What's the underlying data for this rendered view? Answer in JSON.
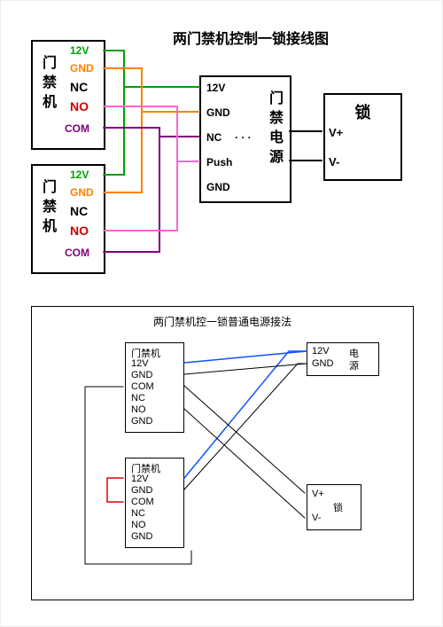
{
  "diagram1": {
    "title": "两门禁机控制一锁接线图",
    "access_unit_label": "门禁机",
    "controller_label": "门禁电源",
    "lock_label": "锁",
    "pins_access": {
      "v12": "12V",
      "gnd": "GND",
      "nc": "NC",
      "no": "NO",
      "com": "COM"
    },
    "pins_ctrl": {
      "v12": "12V",
      "gnd": "GND",
      "nc": "NC",
      "push": "Push",
      "gnd2": "GND"
    },
    "pins_lock": {
      "vplus": "V+",
      "vminus": "V-"
    },
    "colors": {
      "v12": "#00a000",
      "gnd": "#ff8000",
      "com": "#800080",
      "nc": "#d00000",
      "no_push": "#ff66cc",
      "lock": "#000000"
    }
  },
  "diagram2": {
    "title": "两门禁机控一锁普通电源接法",
    "access_unit_label": "门禁机",
    "power_label": "电源",
    "lock_label": "锁",
    "pins_access": {
      "v12": "12V",
      "gnd": "GND",
      "com": "COM",
      "nc": "NC",
      "no": "NO",
      "gnd2": "GND"
    },
    "pins_power": {
      "v12": "12V",
      "gnd": "GND"
    },
    "pins_lock": {
      "vplus": "V+",
      "vminus": "V-"
    }
  }
}
